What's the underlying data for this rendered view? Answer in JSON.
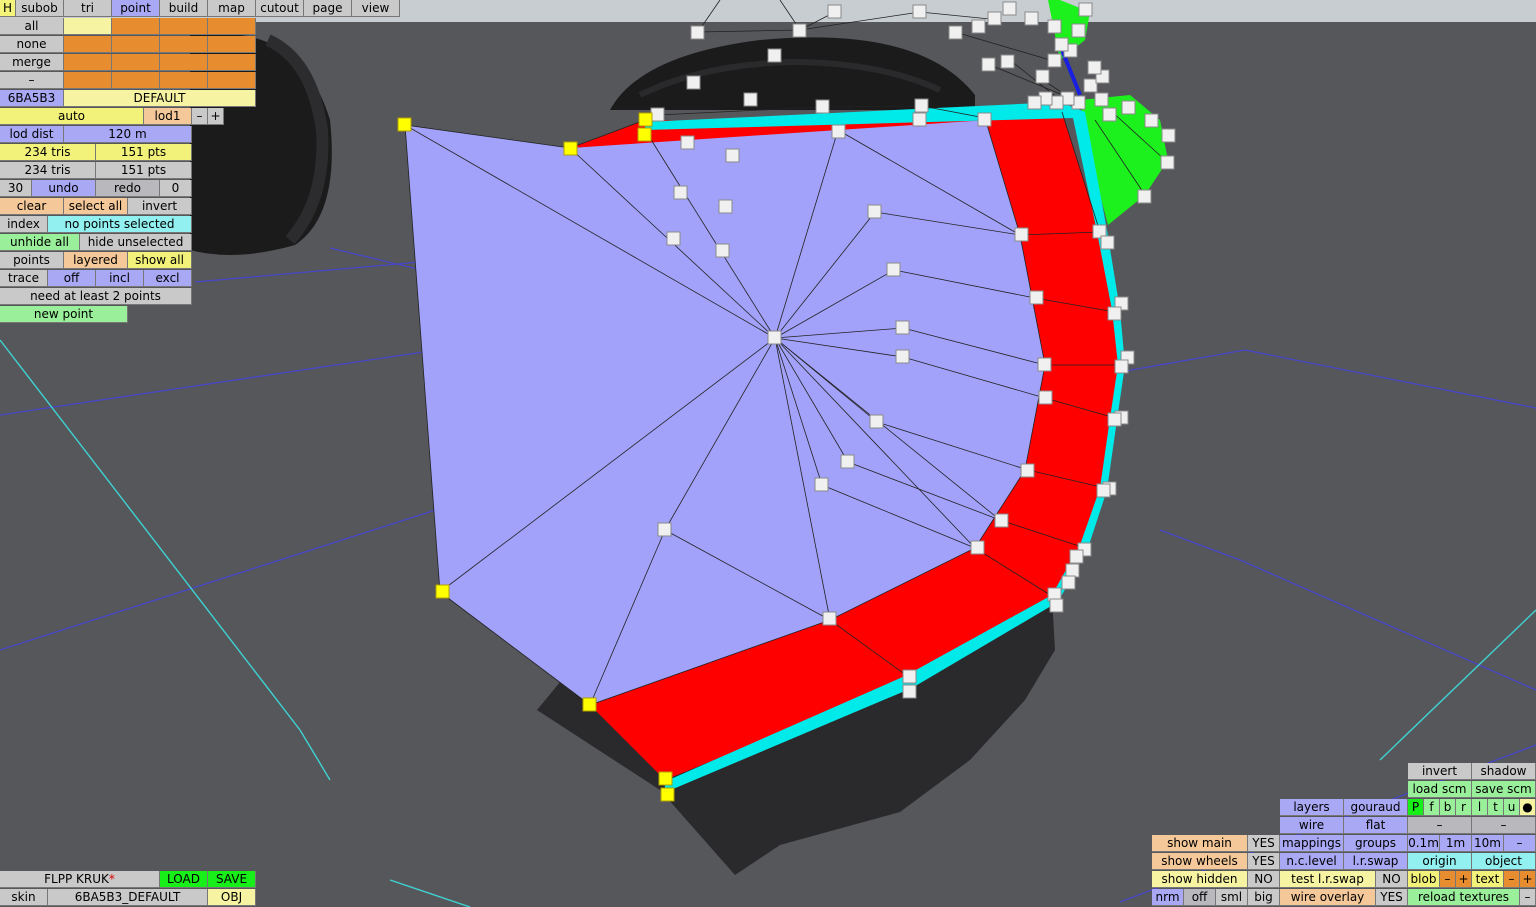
{
  "menu": {
    "items": [
      "H",
      "subob",
      "tri",
      "point",
      "build",
      "map",
      "cutout",
      "page",
      "view"
    ],
    "active": "point"
  },
  "select_rows": [
    "all",
    "none",
    "merge",
    "–"
  ],
  "color_code": "6BA5B3",
  "layer_name": "DEFAULT",
  "lod": {
    "mode": "auto",
    "name": "lod1",
    "minus": "–",
    "plus": "+",
    "dist_label": "lod dist",
    "dist_value": "120 m"
  },
  "stats": {
    "tris_a": "234 tris",
    "pts_a": "151 pts",
    "tris_b": "234 tris",
    "pts_b": "151 pts"
  },
  "history": {
    "count": "30",
    "undo": "undo",
    "redo": "redo",
    "redo_count": "0"
  },
  "selection": {
    "clear": "clear",
    "select_all": "select all",
    "invert": "invert",
    "index": "index",
    "status": "no points selected",
    "unhide_all": "unhide all",
    "hide_unselected": "hide unselected"
  },
  "points_row": {
    "points": "points",
    "layered": "layered",
    "show_all": "show all"
  },
  "trace_row": {
    "trace": "trace",
    "off": "off",
    "incl": "incl",
    "excl": "excl"
  },
  "hint": "need at least 2 points",
  "new_point": "new point",
  "bottom_left": {
    "model_name": "FLPP KRUK",
    "modified_mark": "*",
    "load": "LOAD",
    "save": "SAVE",
    "skin_label": "skin",
    "skin_value": "6BA5B3_DEFAULT",
    "obj": "OBJ"
  },
  "right_panel": {
    "invert": "invert",
    "shadow": "shadow",
    "load_scm": "load scm",
    "save_scm": "save scm",
    "flags": [
      "P",
      "f",
      "b",
      "r",
      "l",
      "t",
      "u",
      "●"
    ],
    "layers": "layers",
    "gouraud": "gouraud",
    "wire": "wire",
    "flat": "flat",
    "dash1": "–",
    "dash2": "–",
    "show_main": "show main",
    "show_main_val": "YES",
    "mappings": "mappings",
    "groups": "groups",
    "d01": "0.1m",
    "d1": "1m",
    "d10": "10m",
    "dm": "–",
    "show_wheels": "show wheels",
    "show_wheels_val": "YES",
    "nc_level": "n.c.level",
    "lr_swap": "l.r.swap",
    "origin": "origin",
    "object": "object",
    "show_hidden": "show hidden",
    "show_hidden_val": "NO",
    "test_lr_swap": "test l.r.swap",
    "test_lr_val": "NO",
    "blob": "blob",
    "text": "text",
    "minus": "–",
    "plus": "+",
    "nrm": "nrm",
    "off": "off",
    "sml": "sml",
    "big": "big",
    "wire_overlay": "wire overlay",
    "wire_overlay_val": "YES",
    "reload_textures": "reload textures"
  }
}
